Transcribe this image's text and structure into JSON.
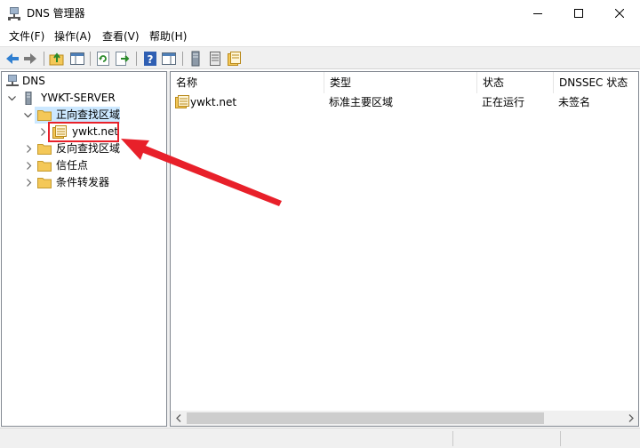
{
  "window": {
    "title": "DNS 管理器",
    "controls": [
      "minimize",
      "maximize",
      "close"
    ]
  },
  "menu": [
    {
      "label": "文件(F)"
    },
    {
      "label": "操作(A)"
    },
    {
      "label": "查看(V)"
    },
    {
      "label": "帮助(H)"
    }
  ],
  "toolbar": {
    "buttons": [
      "back-icon",
      "forward-icon",
      "up-folder-icon",
      "show-hide-tree-icon",
      "refresh-icon",
      "export-list-icon",
      "help-icon",
      "action-pane-icon",
      "server-icon",
      "zone-list-icon",
      "new-zone-icon"
    ]
  },
  "tree": {
    "root": "DNS",
    "server": "YWKT-SERVER",
    "forward_zones": "正向查找区域",
    "zone": "ywkt.net",
    "reverse_zones": "反向查找区域",
    "trust_points": "信任点",
    "conditional_forwarders": "条件转发器"
  },
  "list": {
    "columns": [
      "名称",
      "类型",
      "状态",
      "DNSSEC 状态"
    ],
    "rows": [
      {
        "name": "ywkt.net",
        "type": "标准主要区域",
        "status": "正在运行",
        "dnssec": "未签名"
      }
    ]
  },
  "annotation": {
    "highlight_color": "#e8202a",
    "target": "ywkt.net"
  },
  "colors": {
    "selection": "#cce8ff",
    "folder": "#f4c858",
    "accent_arrow": "#e8202a"
  }
}
